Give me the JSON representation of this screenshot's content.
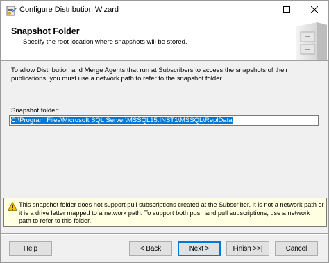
{
  "window": {
    "title": "Configure Distribution Wizard",
    "controls": {
      "minimize": "minimize-icon",
      "maximize": "maximize-icon",
      "close": "close-icon"
    }
  },
  "header": {
    "title": "Snapshot Folder",
    "subtitle": "Specify the root location where snapshots will be stored."
  },
  "body": {
    "description": "To allow Distribution and Merge Agents that run at Subscribers to access the snapshots of their publications, you must use a network path to refer to the snapshot folder.",
    "folder_label": "Snapshot folder:",
    "folder_value": "C:\\Program Files\\Microsoft SQL Server\\MSSQL15.INST1\\MSSQL\\ReplData"
  },
  "warning": {
    "icon": "warning-icon",
    "text": "This snapshot folder does not support pull subscriptions created at the Subscriber. It is not a network path or it is a drive letter mapped to a network path. To support both push and pull subscriptions, use a network path to refer to this folder."
  },
  "buttons": {
    "help": "Help",
    "back": "< Back",
    "next": "Next >",
    "finish": "Finish >>|",
    "cancel": "Cancel"
  },
  "colors": {
    "selection": "#0078d7",
    "warning_bg": "#ffffe1",
    "default_button_border": "#0078d7"
  }
}
